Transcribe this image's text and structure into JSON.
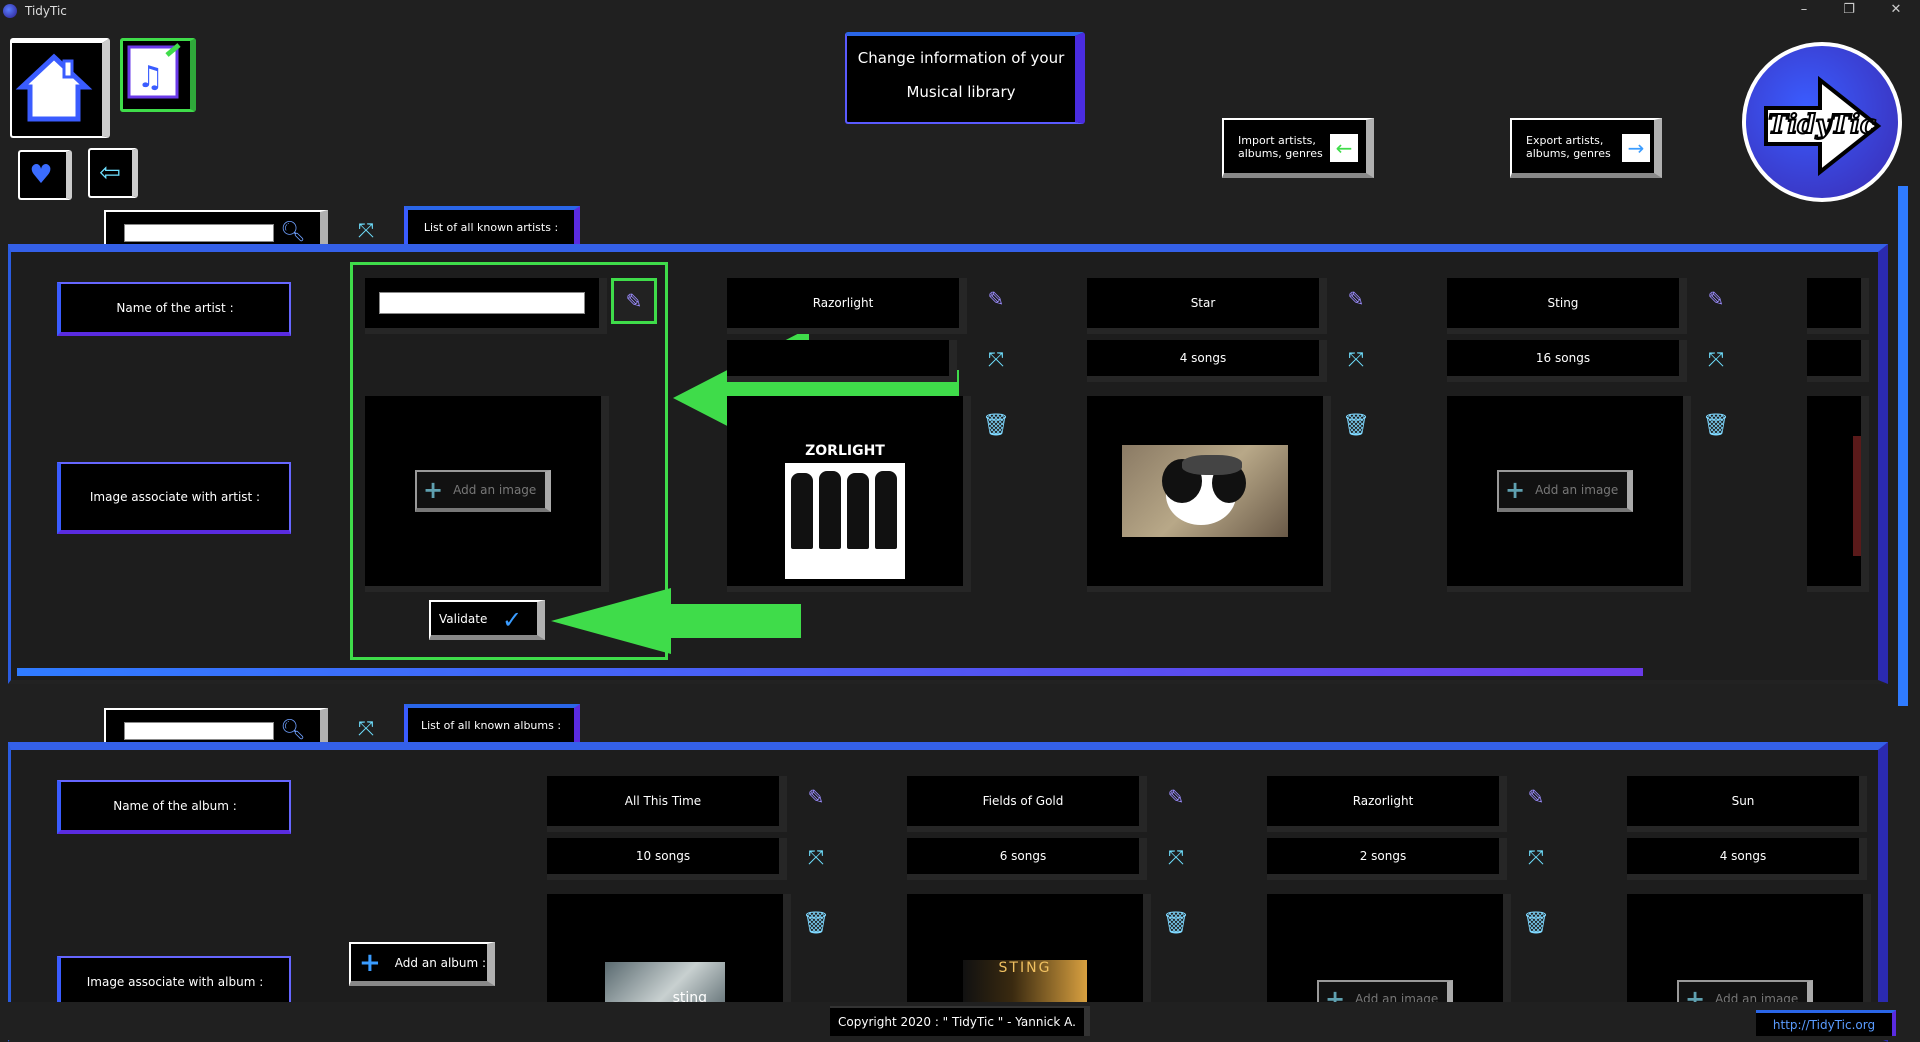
{
  "window": {
    "title": "TidyTic",
    "min": "–",
    "max": "❐",
    "close": "✕"
  },
  "header": {
    "title_line1": "Change information of your",
    "title_line2": "Musical library",
    "import_label_line1": "Import artists,",
    "import_label_line2": "albums, genres",
    "export_label_line1": "Export artists,",
    "export_label_line2": "albums, genres",
    "logo_text": "TidyTic"
  },
  "artists": {
    "tab_label": "List of all known artists :",
    "search_placeholder": "",
    "name_label": "Name of the artist :",
    "image_label": "Image associate with artist :",
    "new_name_value": "",
    "add_image": "Add an image",
    "validate": "Validate",
    "items": [
      {
        "name": "Razorlight",
        "songs": "",
        "poster": "ZORLIGHT"
      },
      {
        "name": "Star",
        "songs": "4 songs"
      },
      {
        "name": "Sting",
        "songs": "16 songs",
        "add_image": "Add an image"
      }
    ]
  },
  "albums": {
    "tab_label": "List of all known albums :",
    "name_label": "Name of the album :",
    "image_label": "Image associate with album :",
    "add_album": "Add an album :",
    "items": [
      {
        "name": "All This Time",
        "songs": "10 songs",
        "cover": "sting"
      },
      {
        "name": "Fields of Gold",
        "songs": "6 songs",
        "cover": "STING"
      },
      {
        "name": "Razorlight",
        "songs": "2 songs",
        "add_image": "Add an image"
      },
      {
        "name": "Sun",
        "songs": "4 songs",
        "add_image": "Add an image"
      }
    ]
  },
  "footer": {
    "copyright": "Copyright 2020 : \" TidyTic \" - Yannick A.",
    "link": "http://TidyTic.org"
  },
  "colors": {
    "accent_blue": "#2a66e8",
    "accent_purple": "#5a2be0",
    "highlight_green": "#3fdc4a"
  }
}
